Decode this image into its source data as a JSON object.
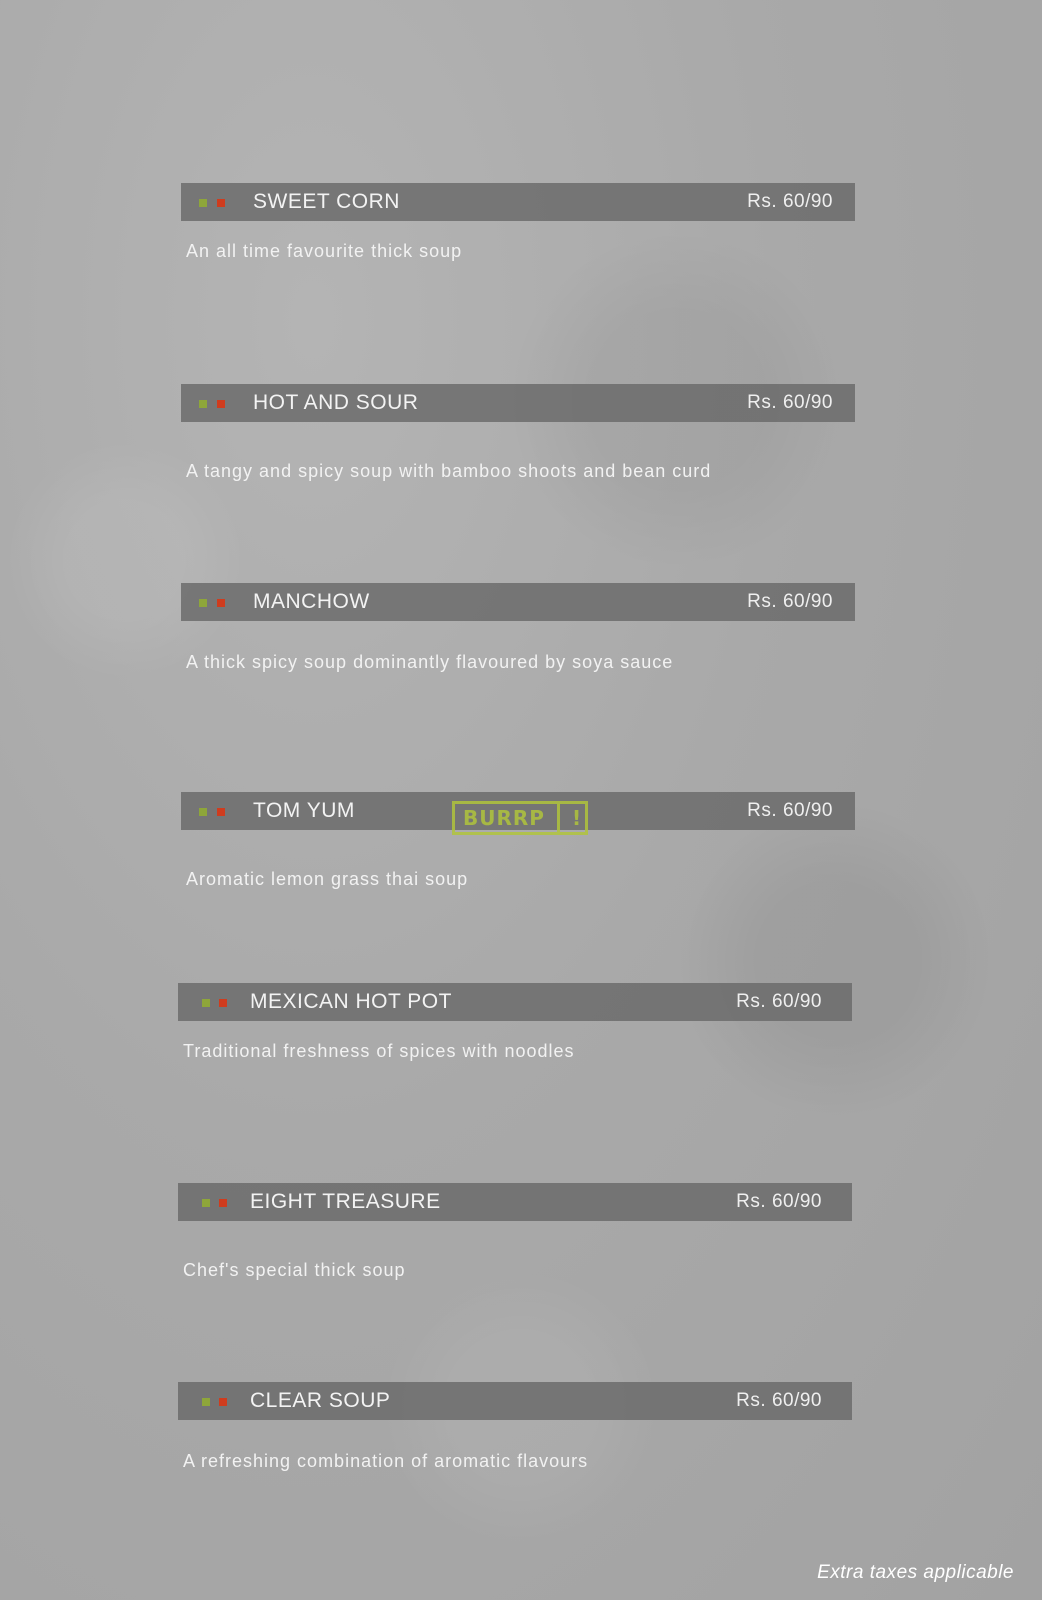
{
  "items": [
    {
      "name": "SWEET CORN",
      "price": "Rs. 60/90",
      "description": "An all time favourite thick soup"
    },
    {
      "name": "HOT AND SOUR",
      "price": "Rs. 60/90",
      "description": "A tangy and spicy soup with bamboo shoots and bean curd"
    },
    {
      "name": "MANCHOW",
      "price": "Rs. 60/90",
      "description": "A thick spicy soup dominantly flavoured by soya sauce"
    },
    {
      "name": "TOM YUM",
      "price": "Rs. 60/90",
      "description": "Aromatic lemon grass thai soup"
    },
    {
      "name": "MEXICAN HOT POT",
      "price": "Rs. 60/90",
      "description": "Traditional freshness of spices with noodles"
    },
    {
      "name": "EIGHT TREASURE",
      "price": "Rs. 60/90",
      "description": "Chef's special thick soup"
    },
    {
      "name": "CLEAR SOUP",
      "price": "Rs. 60/90",
      "description": "A refreshing combination of aromatic flavours"
    }
  ],
  "watermark": {
    "text": "BURRP",
    "mark": "!"
  },
  "footer": "Extra taxes applicable",
  "colors": {
    "veg_marker": "#8ea63a",
    "nonveg_marker": "#cf3c1e",
    "bar": "#6b6b6b"
  }
}
